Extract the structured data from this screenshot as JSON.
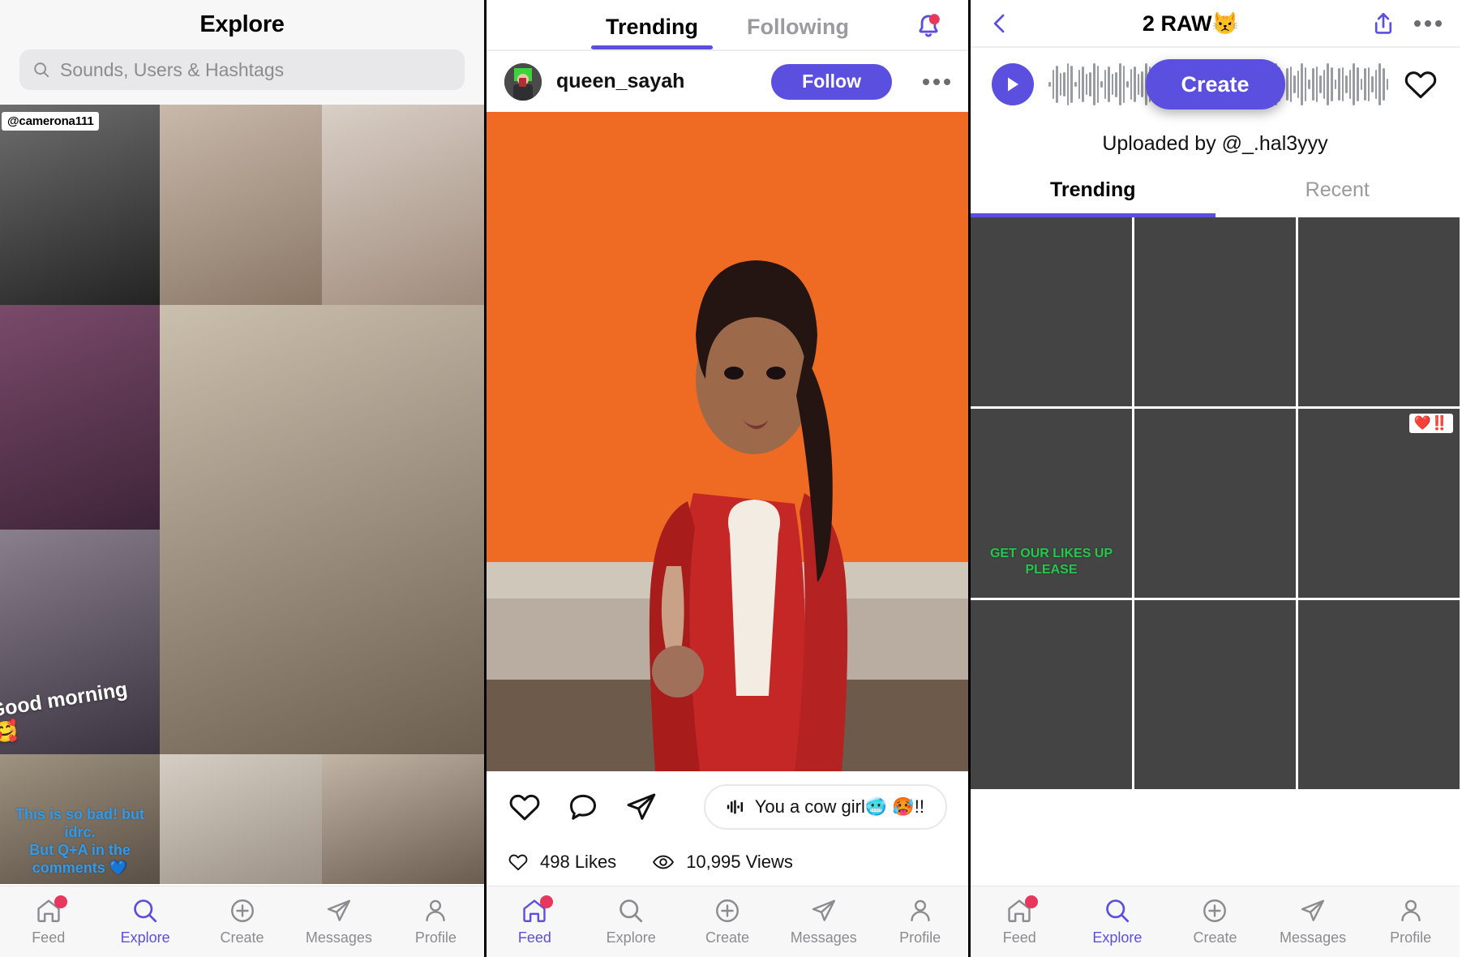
{
  "app": {
    "accent": "#5b4fe0",
    "badge_color": "#e8365d",
    "bg": "#f7f7f8"
  },
  "panel_explore": {
    "title": "Explore",
    "search": {
      "placeholder": "Sounds, Users & Hashtags",
      "value": "",
      "icon": "search-icon"
    },
    "tiles": [
      {
        "overlay_user": "@camerona111",
        "bg": "#6e6e6e",
        "bg2": "#232323"
      },
      {
        "bg": "#c9b9ab",
        "bg2": "#8a7766"
      },
      {
        "bg": "#d9cfc6",
        "bg2": "#a08b7c"
      },
      {
        "bg": "#7a4a6a",
        "bg2": "#3d2438"
      },
      {
        "bg": "#cbbfae",
        "bg2": "#6d5f50"
      },
      {
        "overlay_caption": "Good morning 🥰",
        "bg": "#8a7f8c",
        "bg2": "#3a3340"
      },
      {
        "overlay_caption_blue": "This is so bad! but idrc.\nBut Q+A in the\ncomments 💙",
        "bg": "#9e9280",
        "bg2": "#5a4f44"
      },
      {
        "bg": "#d6cec4",
        "bg2": "#9b9186"
      },
      {
        "bg": "#c2b5a6",
        "bg2": "#6a5d50"
      }
    ],
    "nav": {
      "active": "Explore",
      "items": [
        {
          "label": "Feed",
          "icon": "home-icon",
          "badge": true
        },
        {
          "label": "Explore",
          "icon": "search-icon",
          "badge": false
        },
        {
          "label": "Create",
          "icon": "plus-circle-icon",
          "badge": false
        },
        {
          "label": "Messages",
          "icon": "paper-plane-icon",
          "badge": false
        },
        {
          "label": "Profile",
          "icon": "person-icon",
          "badge": false
        }
      ]
    }
  },
  "panel_feed": {
    "tabs": [
      {
        "label": "Trending",
        "active": true
      },
      {
        "label": "Following",
        "active": false
      }
    ],
    "bell": {
      "icon": "bell-icon",
      "has_notification": true
    },
    "post": {
      "username": "queen_sayah",
      "avatar": "user-avatar",
      "follow_label": "Follow",
      "more_icon": "more-horizontal-icon",
      "actions": [
        {
          "icon": "heart-icon"
        },
        {
          "icon": "comment-icon"
        },
        {
          "icon": "paper-plane-icon"
        }
      ],
      "sound": {
        "icon": "audio-wave-icon",
        "text": "You a cow girl🥶 🥵!!"
      },
      "likes": "498 Likes",
      "views": "10,995 Views",
      "likes_icon": "heart-icon",
      "views_icon": "eye-icon"
    },
    "nav": {
      "active": "Feed",
      "items": [
        {
          "label": "Feed",
          "icon": "home-icon",
          "badge": true
        },
        {
          "label": "Explore",
          "icon": "search-icon",
          "badge": false
        },
        {
          "label": "Create",
          "icon": "plus-circle-icon",
          "badge": false
        },
        {
          "label": "Messages",
          "icon": "paper-plane-icon",
          "badge": false
        },
        {
          "label": "Profile",
          "icon": "person-icon",
          "badge": false
        }
      ]
    }
  },
  "panel_sound": {
    "back_icon": "chevron-left-icon",
    "title": "2 RAW😾",
    "share_icon": "share-icon",
    "more_icon": "more-horizontal-icon",
    "player": {
      "play_icon": "play-icon",
      "waveform": "audio-waveform",
      "create_label": "Create",
      "favorite_icon": "heart-icon"
    },
    "uploader": "Uploaded by @_.hal3yyy",
    "tabs": [
      {
        "label": "Trending",
        "active": true
      },
      {
        "label": "Recent",
        "active": false
      }
    ],
    "tiles": [
      {
        "bg": "#b9ae92",
        "bg2": "#6d6344"
      },
      {
        "bg": "#d6c8c0",
        "bg2": "#8b3b39"
      },
      {
        "bg": "#d8d2c6",
        "bg2": "#7e7566"
      },
      {
        "overlay_green": "GET OUR LIKES UP\nPLEASE",
        "bg": "#7a6253",
        "bg2": "#2f241d"
      },
      {
        "bg": "#9aa0a6",
        "bg2": "#3c4146"
      },
      {
        "overlay_heart": "❤️‼️",
        "bg": "#c1a98f",
        "bg2": "#6b513a"
      },
      {
        "bg": "#e7e3dd",
        "bg2": "#9b958c"
      },
      {
        "bg": "#c4a89c",
        "bg2": "#6b4a3e"
      },
      {
        "bg": "#b9c4cb",
        "bg2": "#4d565e"
      }
    ],
    "nav": {
      "active": "Explore",
      "items": [
        {
          "label": "Feed",
          "icon": "home-icon",
          "badge": true
        },
        {
          "label": "Explore",
          "icon": "search-icon",
          "badge": false
        },
        {
          "label": "Create",
          "icon": "plus-circle-icon",
          "badge": false
        },
        {
          "label": "Messages",
          "icon": "paper-plane-icon",
          "badge": false
        },
        {
          "label": "Profile",
          "icon": "person-icon",
          "badge": false
        }
      ]
    }
  }
}
